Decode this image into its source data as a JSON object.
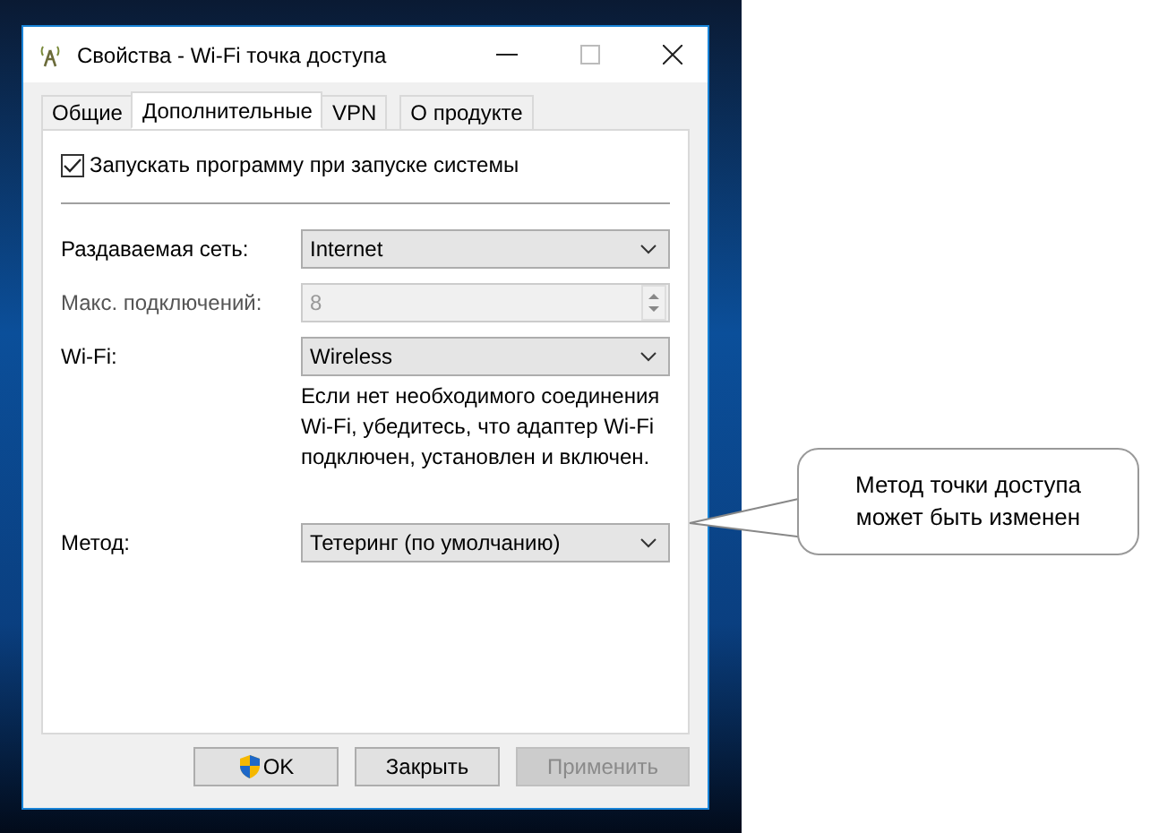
{
  "window": {
    "title": "Свойства - Wi-Fi точка доступа"
  },
  "tabs": [
    {
      "label": "Общие",
      "selected": false
    },
    {
      "label": "Дополнительные",
      "selected": true
    },
    {
      "label": "VPN",
      "selected": false
    },
    {
      "label": "О продукте",
      "selected": false
    }
  ],
  "autostart": {
    "label": "Запускать программу при запуске системы",
    "checked": true
  },
  "fields": [
    {
      "kind": "dropdown",
      "label": "Раздаваемая сеть:",
      "value": "Internet",
      "disabled": false
    },
    {
      "kind": "spinner",
      "label": "Макс. подключений:",
      "value": "8",
      "disabled": true
    },
    {
      "kind": "dropdown",
      "label": "Wi-Fi:",
      "value": "Wireless",
      "disabled": false,
      "hint": "Если нет необходимого соединения Wi-Fi, убедитесь, что адаптер Wi-Fi подключен, установлен и включен."
    },
    {
      "kind": "dropdown",
      "label": "Метод:",
      "value": "Тетеринг (по умолчанию)",
      "disabled": false
    }
  ],
  "buttons": [
    {
      "label": "OK",
      "shield": true,
      "disabled": false
    },
    {
      "label": "Закрыть",
      "shield": false,
      "disabled": false
    },
    {
      "label": "Применить",
      "shield": false,
      "disabled": true
    }
  ],
  "callout": {
    "text": "Метод точки доступа может быть изменен"
  }
}
